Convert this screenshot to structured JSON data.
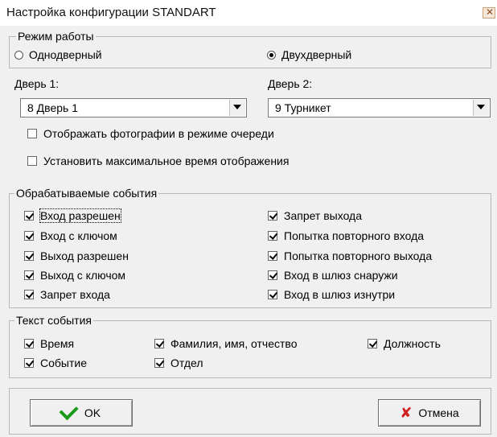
{
  "window": {
    "title": "Настройка конфигурации STANDART"
  },
  "mode": {
    "label": "Режим работы",
    "single": "Однодверный",
    "double": "Двухдверный",
    "selected": "double"
  },
  "door1": {
    "label": "Дверь 1:",
    "value": "8 Дверь 1"
  },
  "door2": {
    "label": "Дверь 2:",
    "value": "9 Турникет"
  },
  "options": [
    {
      "label": "Отображать фотографии в режиме очереди",
      "checked": false
    },
    {
      "label": "Установить максимальное время отображения",
      "checked": false
    }
  ],
  "events": {
    "label": "Обрабатываемые события",
    "left": [
      {
        "label": "Вход разрешен",
        "checked": true
      },
      {
        "label": "Вход с ключом",
        "checked": true
      },
      {
        "label": "Выход разрешен",
        "checked": true
      },
      {
        "label": "Выход с ключом",
        "checked": true
      },
      {
        "label": "Запрет входа",
        "checked": true
      }
    ],
    "right": [
      {
        "label": "Запрет выхода",
        "checked": true
      },
      {
        "label": "Попытка повторного входа",
        "checked": true
      },
      {
        "label": "Попытка повторного выхода",
        "checked": true
      },
      {
        "label": "Вход в шлюз снаружи",
        "checked": true
      },
      {
        "label": "Вход в шлюз изнутри",
        "checked": true
      }
    ]
  },
  "event_text": {
    "label": "Текст события",
    "time": "Время",
    "event": "Событие",
    "full_name": "Фамилия, имя, отчество",
    "department": "Отдел",
    "position": "Должность"
  },
  "buttons": {
    "ok": "OK",
    "cancel": "Отмена"
  },
  "colors": {
    "ok_icon": "#1a9a1a",
    "cancel_icon": "#d02020"
  },
  "icons": {
    "ok": "green-checkmark-icon",
    "cancel": "red-x-icon",
    "close": "close-icon"
  }
}
